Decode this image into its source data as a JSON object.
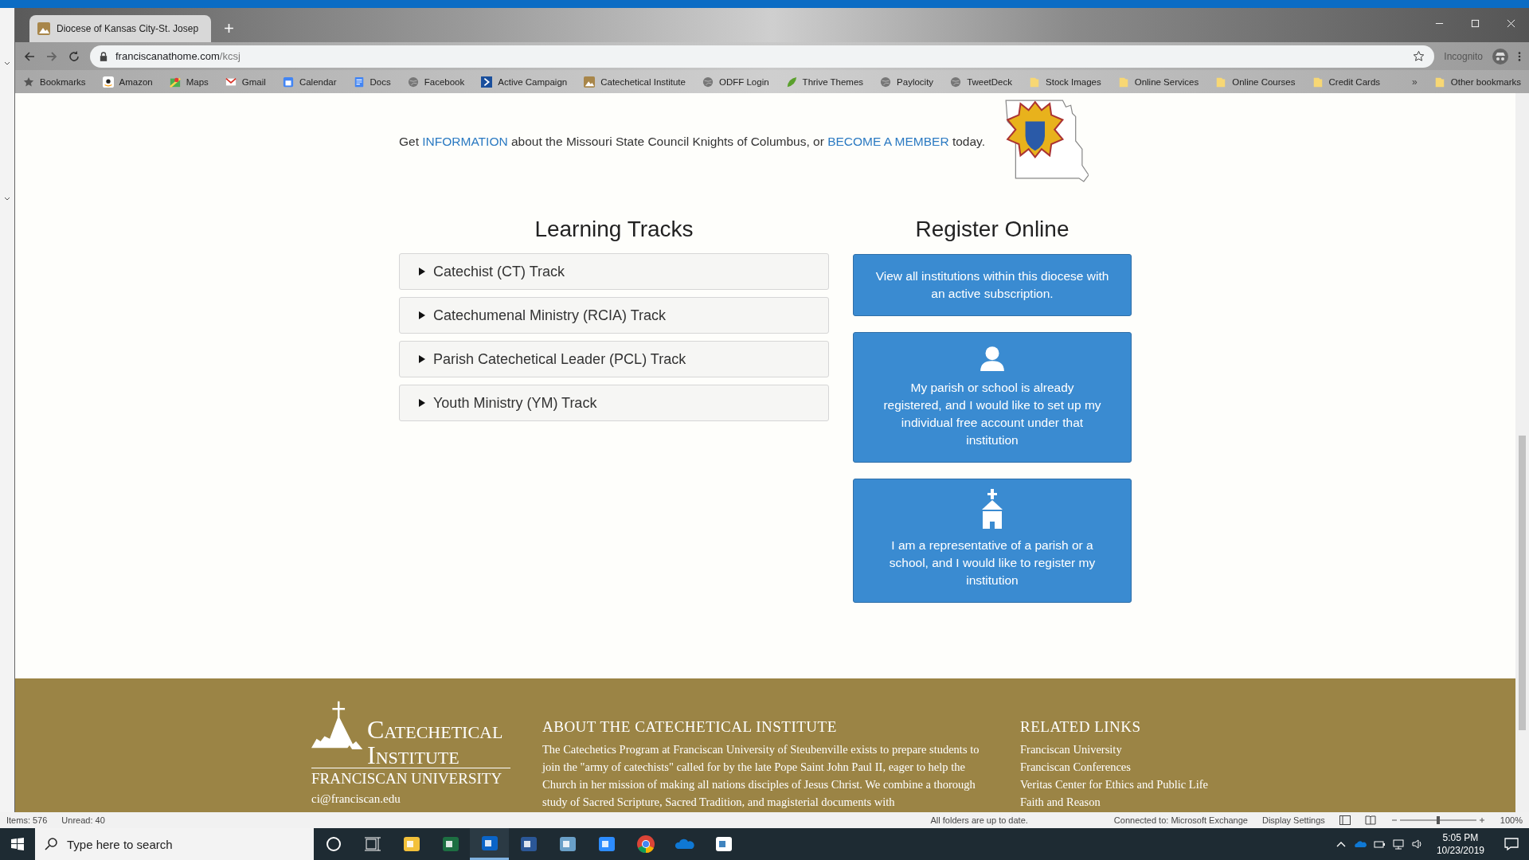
{
  "browser": {
    "tab": {
      "title": "Diocese of Kansas City-St. Josep",
      "selected": true
    },
    "address": {
      "host": "franciscanathome.com",
      "path": "/kcsj"
    },
    "incognito": "Incognito",
    "bookmarks": [
      {
        "label": "Bookmarks",
        "kind": "star"
      },
      {
        "label": "Amazon",
        "kind": "amazon"
      },
      {
        "label": "Maps",
        "kind": "maps"
      },
      {
        "label": "Gmail",
        "kind": "gmail"
      },
      {
        "label": "Calendar",
        "kind": "calendar"
      },
      {
        "label": "Docs",
        "kind": "docs"
      },
      {
        "label": "Facebook",
        "kind": "globe"
      },
      {
        "label": "Active Campaign",
        "kind": "campaign"
      },
      {
        "label": "Catechetical Institute",
        "kind": "site"
      },
      {
        "label": "ODFF Login",
        "kind": "globe"
      },
      {
        "label": "Thrive Themes",
        "kind": "leaf"
      },
      {
        "label": "Paylocity",
        "kind": "globe"
      },
      {
        "label": "TweetDeck",
        "kind": "globe"
      },
      {
        "label": "Stock Images",
        "kind": "folder"
      },
      {
        "label": "Online Services",
        "kind": "folder"
      },
      {
        "label": "Online Courses",
        "kind": "folder"
      },
      {
        "label": "Credit Cards",
        "kind": "folder"
      }
    ],
    "more": "»",
    "other_bookmarks": "Other bookmarks"
  },
  "page": {
    "intro": {
      "before": "Get ",
      "link1": "INFORMATION",
      "middle": " about the Missouri State Council Knights of Columbus, or ",
      "link2": "BECOME A MEMBER",
      "after": " today."
    },
    "learning_tracks": {
      "title": "Learning Tracks",
      "items": [
        {
          "label": "Catechist (CT) Track",
          "expanded": false
        },
        {
          "label": "Catechumenal Ministry (RCIA) Track",
          "expanded": false
        },
        {
          "label": "Parish Catechetical Leader (PCL) Track",
          "expanded": false
        },
        {
          "label": "Youth Ministry (YM) Track",
          "expanded": false
        }
      ]
    },
    "register": {
      "title": "Register Online",
      "buttons": [
        {
          "kind": "text",
          "label": "View all institutions within this diocese with an active subscription."
        },
        {
          "kind": "person",
          "label": "My parish or school is already registered, and I would like to set up my individual free account under that institution"
        },
        {
          "kind": "church",
          "label": "I am a representative of a parish or a school, and I would like to register my institution"
        }
      ]
    },
    "footer": {
      "logo_line1": "Catechetical",
      "logo_line2": "Institute",
      "logo_sub": "FRANCISCAN UNIVERSITY",
      "email": "ci@franciscan.edu",
      "about_title": "ABOUT THE CATECHETICAL INSTITUTE",
      "about_text": "The Catechetics Program at Franciscan University of Steubenville exists to prepare students to join the \"army of catechists\" called for by the late Pope Saint John Paul II, eager to help the Church in her mission of making all nations disciples of Jesus Christ. We combine a thorough study of Sacred Scripture, Sacred Tradition, and magisterial documents with",
      "related_title": "RELATED LINKS",
      "links": [
        "Franciscan University",
        "Franciscan Conferences",
        "Veritas Center for Ethics and Public Life",
        "Faith and Reason"
      ]
    }
  },
  "outlook_status": {
    "items": "Items: 576",
    "unread": "Unread: 40",
    "sync": "All folders are up to date.",
    "connection": "Connected to: Microsoft Exchange",
    "display": "Display Settings",
    "zoom": "100%",
    "zoom_slider": {
      "level": 0.5
    }
  },
  "taskbar": {
    "search_placeholder": "Type here to search",
    "apps": [
      {
        "kind": "cortana",
        "selected": false
      },
      {
        "kind": "taskview",
        "selected": false
      },
      {
        "kind": "explorer",
        "selected": false
      },
      {
        "kind": "excel",
        "selected": false
      },
      {
        "kind": "outlook",
        "selected": true
      },
      {
        "kind": "word",
        "selected": false
      },
      {
        "kind": "nx",
        "selected": false
      },
      {
        "kind": "zoom",
        "selected": false
      },
      {
        "kind": "chrome",
        "selected": false
      },
      {
        "kind": "onedrive",
        "selected": false
      },
      {
        "kind": "vapp",
        "selected": false
      }
    ],
    "time": "5:05 PM",
    "date": "10/23/2019"
  }
}
